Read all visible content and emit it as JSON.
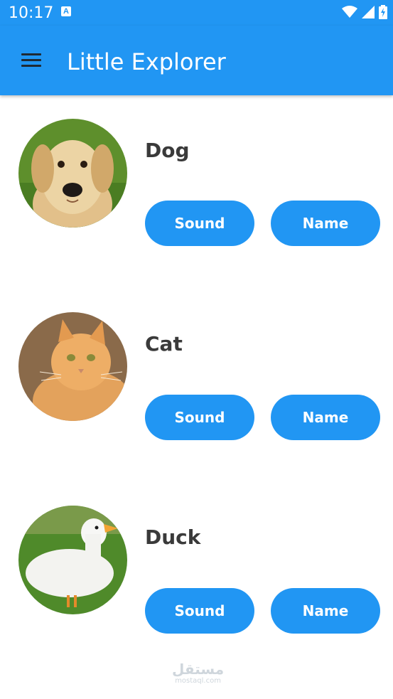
{
  "status_bar": {
    "time": "10:17",
    "notification_icon_letter": "A",
    "icons": [
      "wifi-icon",
      "signal-icon",
      "battery-charging-icon"
    ]
  },
  "app_bar": {
    "title": "Little Explorer",
    "menu_icon": "hamburger-menu-icon",
    "background_color": "#2196F3"
  },
  "animals": [
    {
      "name": "Dog",
      "sound_label": "Sound",
      "name_label": "Name"
    },
    {
      "name": "Cat",
      "sound_label": "Sound",
      "name_label": "Name"
    },
    {
      "name": "Duck",
      "sound_label": "Sound",
      "name_label": "Name"
    }
  ],
  "watermark": {
    "main": "مستقل",
    "sub": "mostaql.com"
  },
  "colors": {
    "button": "#2196F3",
    "button_text": "#ffffff",
    "animal_name": "#3a3a3a"
  }
}
